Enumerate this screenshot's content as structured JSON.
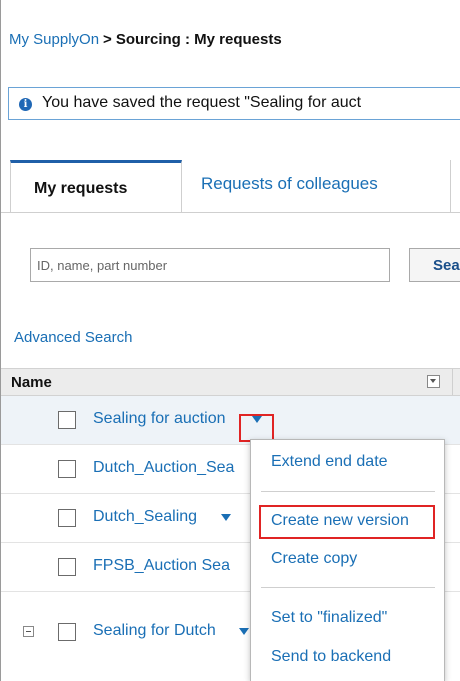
{
  "breadcrumb": {
    "home": "My SupplyOn",
    "separator": ">",
    "current": "Sourcing : My requests"
  },
  "info_bar": {
    "icon": "info-icon",
    "icon_glyph": "i",
    "message": "You have saved the request \"Sealing for auct"
  },
  "tabs": {
    "active": "My requests",
    "other": "Requests of colleagues"
  },
  "search": {
    "placeholder": "ID, name, part number",
    "value": "",
    "button_label": "Search"
  },
  "advanced_search_label": "Advanced Search",
  "grid": {
    "column_header": "Name",
    "rows": [
      {
        "name": "Sealing for auction"
      },
      {
        "name": "Dutch_Auction_Sea"
      },
      {
        "name": "Dutch_Sealing"
      },
      {
        "name": "FPSB_Auction Sea"
      },
      {
        "name": "Sealing for Dutch"
      }
    ]
  },
  "context_menu": {
    "items": [
      "Extend end date",
      "Create new version",
      "Create copy",
      "Set to \"finalized\"",
      "Send to backend"
    ]
  },
  "colors": {
    "link": "#1a6fb5",
    "highlight": "#e02424",
    "tab_accent": "#1f5fa8",
    "info_border": "#6aa3d6"
  }
}
